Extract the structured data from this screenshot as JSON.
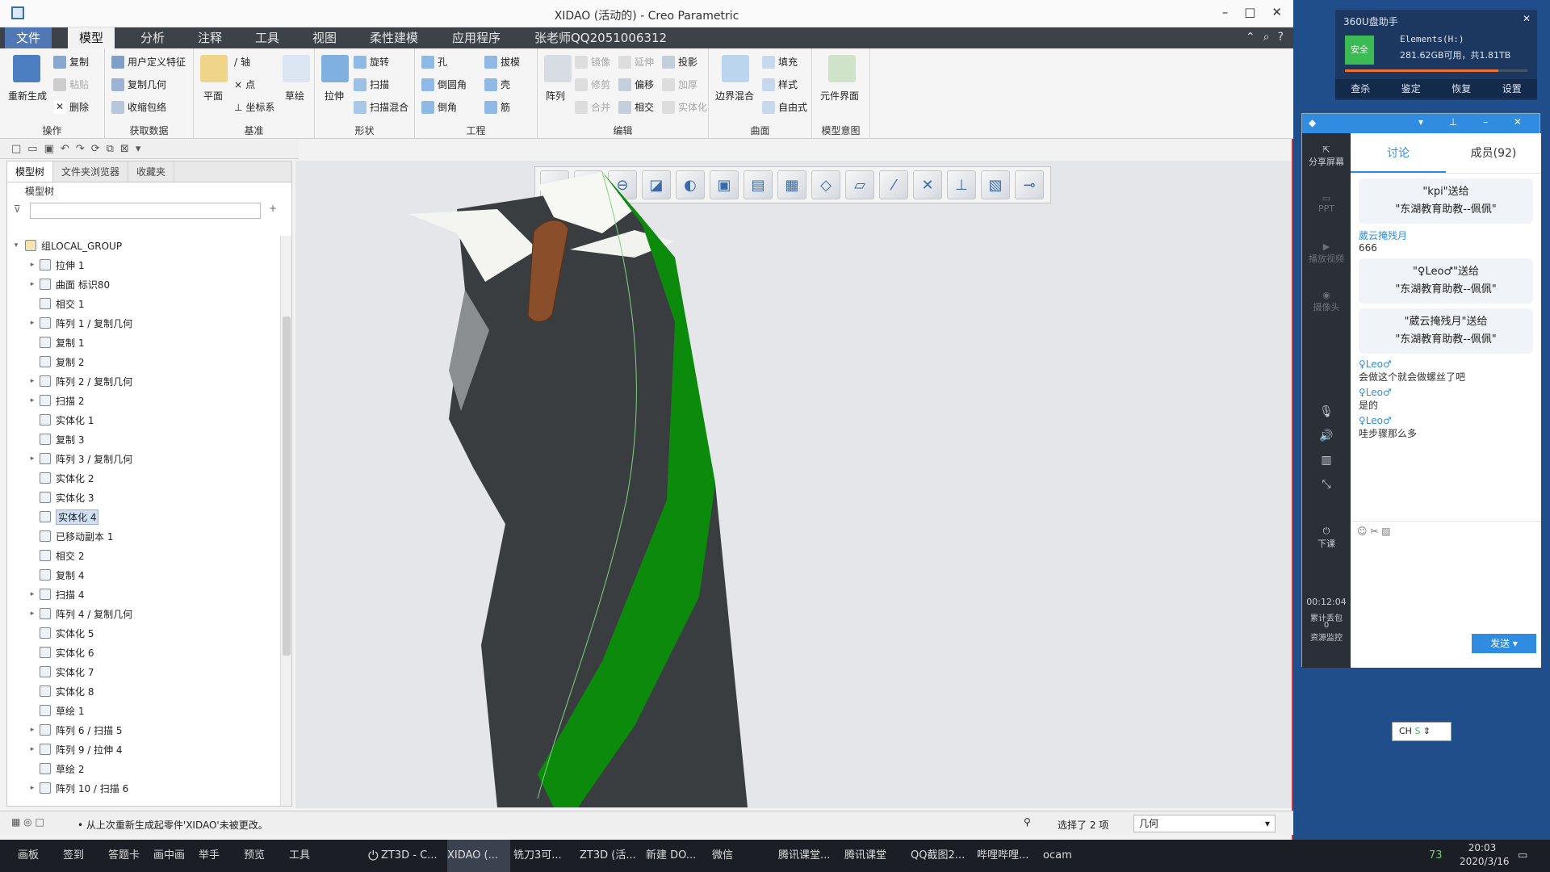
{
  "window": {
    "title": "XIDAO (活动的) - Creo Parametric"
  },
  "menu_tabs": [
    {
      "label": "文件"
    },
    {
      "label": "模型"
    },
    {
      "label": "分析"
    },
    {
      "label": "注释"
    },
    {
      "label": "工具"
    },
    {
      "label": "视图"
    },
    {
      "label": "柔性建模"
    },
    {
      "label": "应用程序"
    },
    {
      "label": "张老师QQ2051006312"
    }
  ],
  "ribbon": {
    "regen": "重新生成",
    "copy": "复制",
    "paste": "粘贴",
    "delete": "删除",
    "udf": "用户定义特征",
    "copy_geom": "复制几何",
    "shrinkwrap": "收缩包络",
    "plane": "平面",
    "axis": "轴",
    "point": "点",
    "csys": "坐标系",
    "sketch": "草绘",
    "extrude": "拉伸",
    "revolve": "旋转",
    "sweep": "扫描",
    "swept_blend": "扫描混合",
    "hole": "孔",
    "round": "倒圆角",
    "chamfer": "倒角",
    "draft": "拔模",
    "shell": "壳",
    "rib": "筋",
    "pattern": "阵列",
    "mirror": "镜像",
    "extend": "延伸",
    "project": "投影",
    "trim": "修剪",
    "offset": "偏移",
    "thicken": "加厚",
    "merge": "合并",
    "intersect": "相交",
    "solidify": "实体化",
    "boundary_blend": "边界混合",
    "fill": "填充",
    "style": "样式",
    "freestyle": "自由式",
    "component_interface": "元件界面",
    "groups": {
      "ops": "操作",
      "get_data": "获取数据",
      "datum": "基准",
      "shapes": "形状",
      "engineering": "工程",
      "editing": "编辑",
      "surfaces": "曲面",
      "model_intent": "模型意图"
    }
  },
  "panel": {
    "tabs": [
      {
        "label": "模型树"
      },
      {
        "label": "文件夹浏览器"
      },
      {
        "label": "收藏夹"
      }
    ],
    "header": "模型树",
    "root": "组LOCAL_GROUP",
    "items": [
      {
        "label": "拉伸 1",
        "expand": true
      },
      {
        "label": "曲面 标识80",
        "expand": true
      },
      {
        "label": "相交 1",
        "expand": false
      },
      {
        "label": "阵列 1 / 复制几何",
        "expand": true
      },
      {
        "label": "复制 1",
        "expand": false
      },
      {
        "label": "复制 2",
        "expand": false
      },
      {
        "label": "阵列 2 / 复制几何",
        "expand": true
      },
      {
        "label": "扫描 2",
        "expand": true
      },
      {
        "label": "实体化 1",
        "expand": false
      },
      {
        "label": "复制 3",
        "expand": false
      },
      {
        "label": "阵列 3 / 复制几何",
        "expand": true
      },
      {
        "label": "实体化 2",
        "expand": false
      },
      {
        "label": "实体化 3",
        "expand": false
      },
      {
        "label": "实体化 4",
        "expand": false,
        "selected": true
      },
      {
        "label": "已移动副本 1",
        "expand": false
      },
      {
        "label": "相交 2",
        "expand": false
      },
      {
        "label": "复制 4",
        "expand": false
      },
      {
        "label": "扫描 4",
        "expand": true
      },
      {
        "label": "阵列 4 / 复制几何",
        "expand": true
      },
      {
        "label": "实体化 5",
        "expand": false
      },
      {
        "label": "实体化 6",
        "expand": false
      },
      {
        "label": "实体化 7",
        "expand": false
      },
      {
        "label": "实体化 8",
        "expand": false
      },
      {
        "label": "草绘 1",
        "expand": false
      },
      {
        "label": "阵列 6 / 扫描 5",
        "expand": true
      },
      {
        "label": "阵列 9 / 拉伸 4",
        "expand": true
      },
      {
        "label": "草绘 2",
        "expand": false
      },
      {
        "label": "阵列 10 / 扫描 6",
        "expand": true
      }
    ]
  },
  "status": {
    "message": "• 从上次重新生成起零件'XIDAO'未被更改。",
    "selection": "选择了 2 项",
    "filter": "几何"
  },
  "widget": {
    "title": "360U盘助手",
    "badge": "安全",
    "drive": "Elements(H:)",
    "capacity": "281.62GB可用，共1.81TB",
    "actions": [
      "查杀",
      "鉴定",
      "恢复",
      "设置"
    ]
  },
  "chat": {
    "tabs": [
      {
        "label": "讨论"
      },
      {
        "label": "成员(92)"
      }
    ],
    "side": {
      "share": "分享屏幕",
      "ppt": "PPT",
      "video": "播放视频",
      "camera": "摄像头",
      "end": "下课",
      "timer": "00:12:04",
      "gift_label": "累计丢包",
      "gift_count": "0",
      "resource": "资源监控"
    },
    "gifts": [
      {
        "line1": "\"kpi\"送给",
        "line2": "\"东湖教育助教--佩佩\""
      },
      {
        "line1": "\"♀Leo♂\"送给",
        "line2": "\"东湖教育助教--佩佩\""
      },
      {
        "line1": "\"葳云掩残月\"送给",
        "line2": "\"东湖教育助教--佩佩\""
      }
    ],
    "messages": [
      {
        "who": "葳云掩残月",
        "text": "666"
      },
      {
        "who": "♀Leo♂",
        "text": "会做这个就会做螺丝了吧"
      },
      {
        "who": "♀Leo♂",
        "text": "是的"
      },
      {
        "who": "♀Leo♂",
        "text": "哇步骤那么多"
      }
    ],
    "send": "发送"
  },
  "ime": "CH",
  "taskbar": {
    "left": [
      "画板",
      "签到",
      "答题卡",
      "画中画",
      "举手",
      "预览",
      "工具"
    ],
    "apps": [
      "ZT3D - C...",
      "XIDAO (...",
      "铣刀3可...",
      "ZT3D (活...",
      "新建 DO...",
      "微信",
      "腾讯课堂...",
      "腾讯课堂",
      "QQ截图2...",
      "哔哩哔哩...",
      "ocam"
    ],
    "time": "20:03",
    "date": "2020/3/16",
    "temp": "73"
  }
}
